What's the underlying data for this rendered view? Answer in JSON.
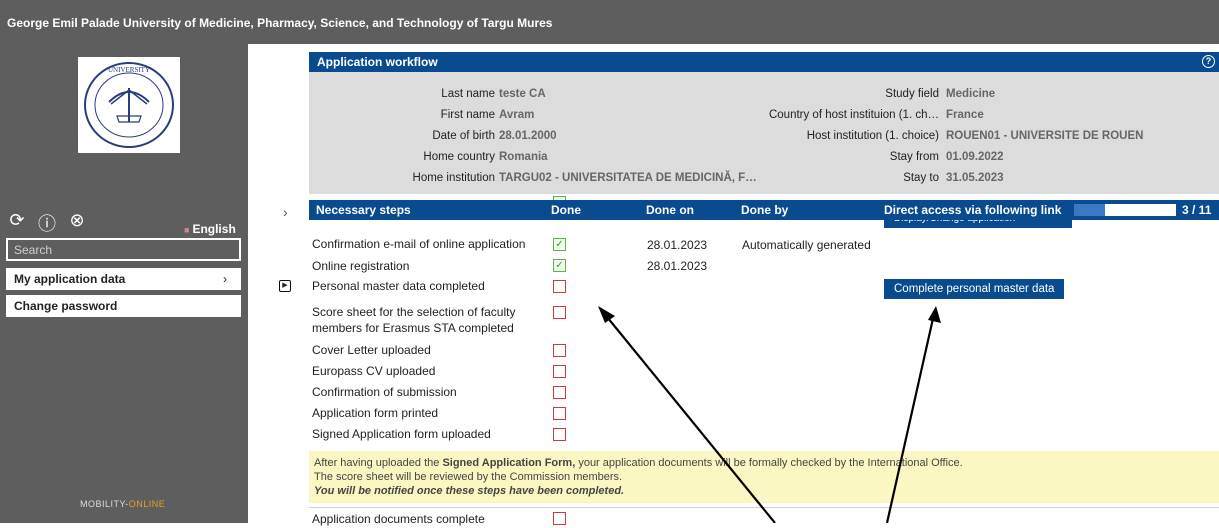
{
  "header": {
    "title": "George Emil Palade University of Medicine, Pharmacy, Science, and Technology of Targu Mures"
  },
  "sidebar": {
    "logo_text": "UNIVERSITY",
    "icons": [
      "refresh-icon",
      "help-icon",
      "close-icon"
    ],
    "language": "English",
    "search_placeholder": "Search",
    "items": [
      {
        "label": "My application data"
      },
      {
        "label": "Change password"
      }
    ],
    "footer_logo_a": "MOBILITY-",
    "footer_logo_b": "ONLINE"
  },
  "workflow": {
    "title": "Application workflow",
    "left": [
      {
        "label": "Last name",
        "value": "teste CA"
      },
      {
        "label": "First name",
        "value": "Avram"
      },
      {
        "label": "Date of birth",
        "value": "28.01.2000"
      },
      {
        "label": "Home country",
        "value": "Romania"
      },
      {
        "label": "Home institution",
        "value": "TARGU02 - UNIVERSITATEA DE MEDICINĂ, F…"
      }
    ],
    "right": [
      {
        "label": "Study field",
        "value": "Medicine"
      },
      {
        "label": "Country of host instituion (1. ch…",
        "value": "France"
      },
      {
        "label": "Host institution (1. choice)",
        "value": "ROUEN01 - UNIVERSITE DE ROUEN"
      },
      {
        "label": "Stay from",
        "value": "01.09.2022"
      },
      {
        "label": "Stay to",
        "value": "31.05.2023"
      }
    ]
  },
  "steps": {
    "headers": {
      "step": "Necessary steps",
      "done": "Done",
      "done_on": "Done on",
      "done_by": "Done by",
      "link": "Direct access via following link"
    },
    "progress_text": "3 / 11",
    "progress_fraction": 0.3,
    "partial_link": "Display/Change application",
    "rows": [
      {
        "label": "Confirmation e-mail of online application",
        "done": true,
        "done_on": "28.01.2023",
        "done_by": "Automatically generated"
      },
      {
        "label": "Online registration",
        "done": true,
        "done_on": "28.01.2023",
        "done_by": ""
      },
      {
        "label": "Personal master data completed",
        "done": false,
        "done_on": "",
        "done_by": "",
        "link": "Complete personal master data"
      },
      {
        "label": "Score sheet for the selection of faculty",
        "label2": "members for Erasmus STA completed",
        "done": false
      },
      {
        "label": "Cover Letter uploaded",
        "done": false
      },
      {
        "label": "Europass CV uploaded",
        "done": false
      },
      {
        "label": "Confirmation of submission",
        "done": false
      },
      {
        "label": "Application form printed",
        "done": false
      },
      {
        "label": "Signed Application form uploaded",
        "done": false
      },
      {
        "label": "Application documents complete",
        "done": false
      }
    ],
    "notice": {
      "line1_pre": "After having uploaded the ",
      "line1_bold": "Signed Application Form,",
      "line1_post": " your application documents will be formally checked by the International Office.",
      "line2": "The score sheet will be reviewed by the Commission members.",
      "line3": "You will be notified once these steps have been completed."
    }
  }
}
